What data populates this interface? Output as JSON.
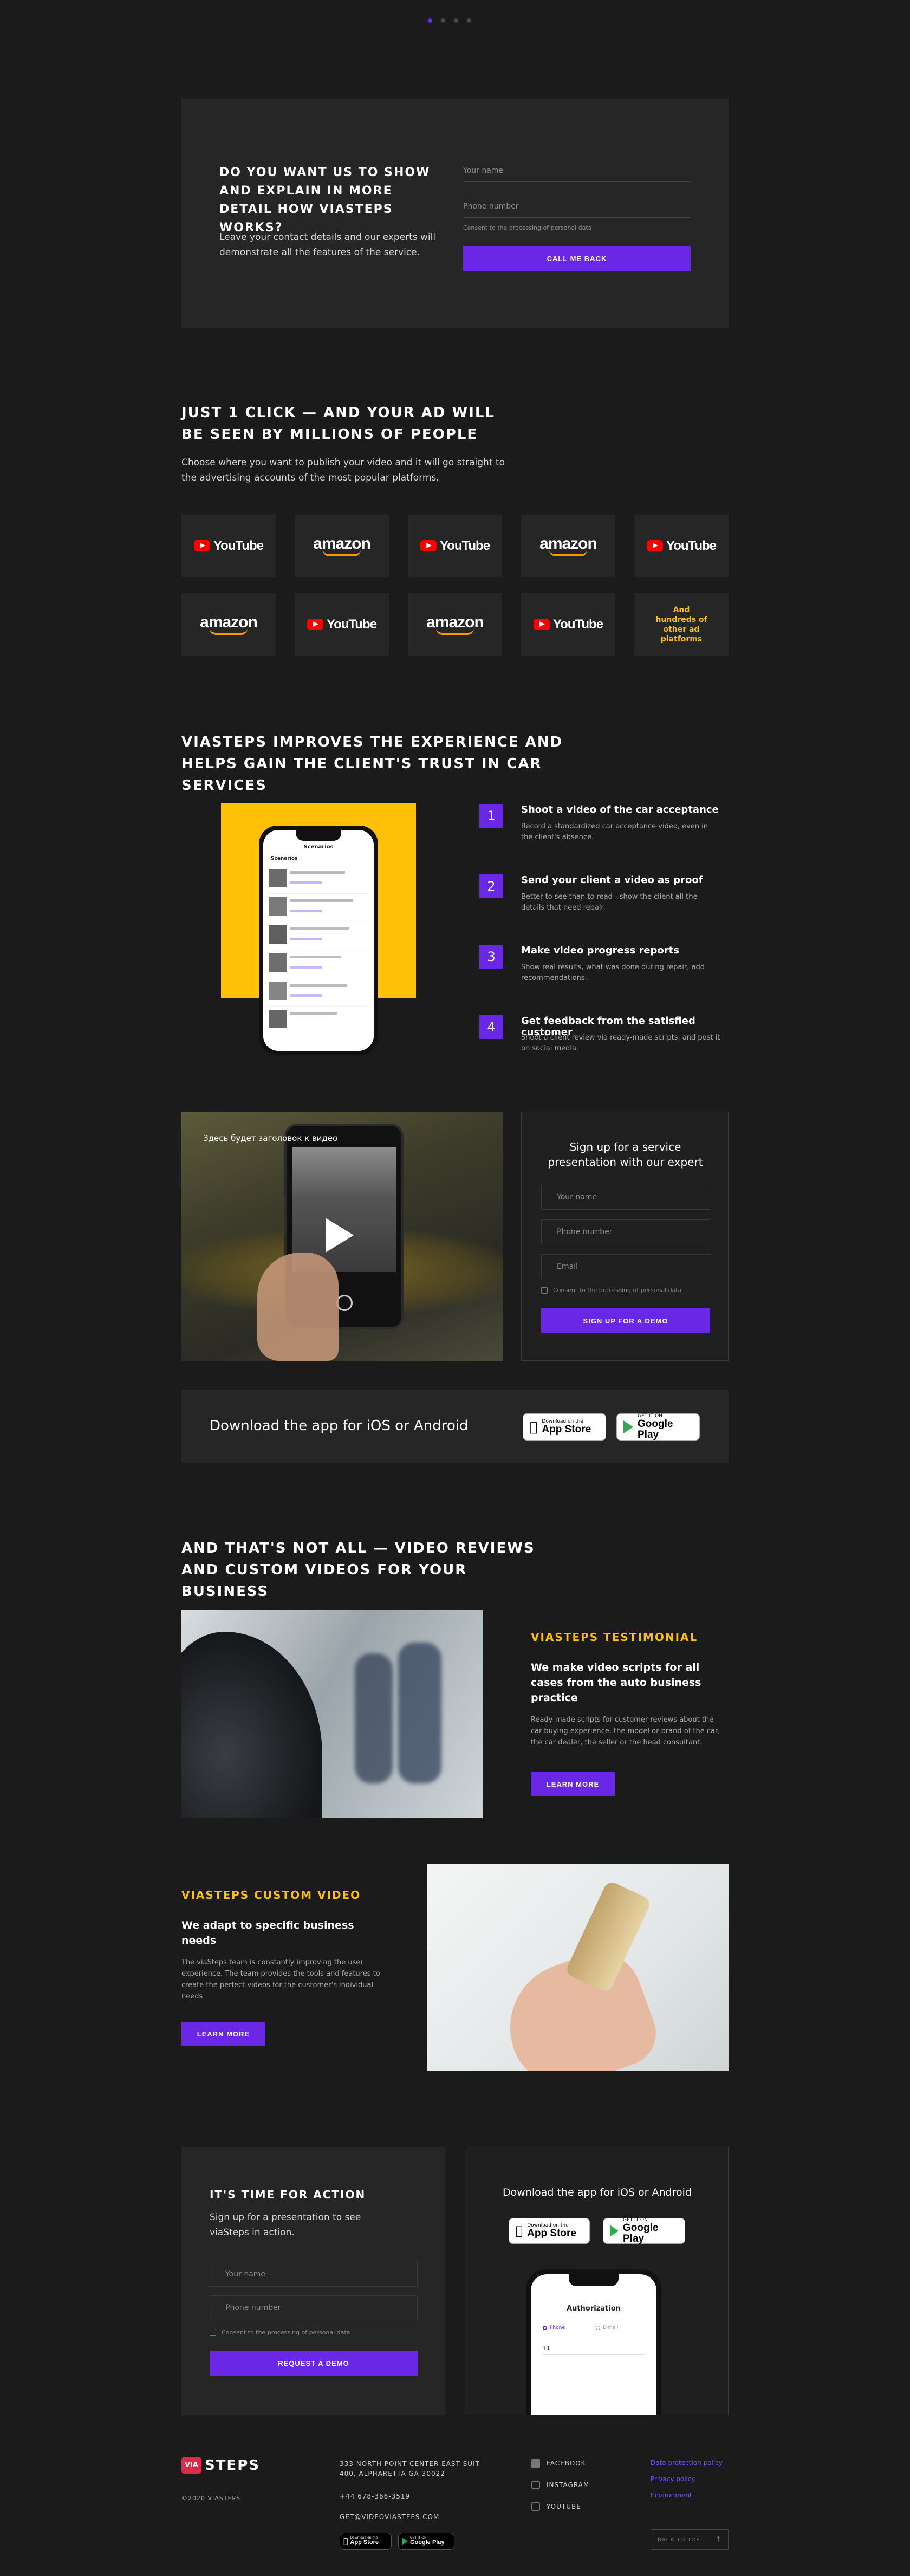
{
  "colors": {
    "accent": "#6a28e6",
    "yellow": "#ffc107",
    "bg": "#1b1b1b",
    "panel": "#232323"
  },
  "top_callback": {
    "heading": "DO YOU WANT US TO SHOW AND EXPLAIN IN MORE DETAIL HOW VIASTEPS WORKS?",
    "text": "Leave your contact details and our experts will demonstrate all the features of the service.",
    "name_placeholder": "Your name",
    "phone_placeholder": "Phone number",
    "consent": "Consent to the processing of personal data",
    "button": "CALL ME BACK"
  },
  "platforms": {
    "heading": "JUST 1 CLICK — AND YOUR AD WILL BE SEEN BY MILLIONS OF PEOPLE",
    "text": "Choose where you want to publish your video and it will go straight to the advertising accounts of the most popular platforms.",
    "youtube_label": "YouTube",
    "amazon_label": "amazon",
    "more_label": "And hundreds of other ad platforms"
  },
  "experience": {
    "heading": "VIASTEPS IMPROVES THE EXPERIENCE AND HELPS GAIN THE CLIENT'S TRUST IN CAR SERVICES",
    "phone_title": "Scenarios",
    "phone_subtitle": "Scenarios",
    "steps": [
      {
        "num": "1",
        "title": "Shoot a video of the car acceptance",
        "text": "Record a standardized car acceptance video, even in the client's absence."
      },
      {
        "num": "2",
        "title": "Send your client a video as proof",
        "text": "Better to see than to read - show the client all the details that need repair."
      },
      {
        "num": "3",
        "title": "Make video progress reports",
        "text": "Show real results, what was done during repair, add recommendations."
      },
      {
        "num": "4",
        "title": "Get feedback from the satisfied customer",
        "text": "Shoot a client review via ready-made scripts, and post it on social media."
      }
    ]
  },
  "demo": {
    "video_caption": "Здесь будет заголовок к видео",
    "heading": "Sign up for a service presentation with our expert",
    "name_placeholder": "Your name",
    "phone_placeholder": "Phone number",
    "email_placeholder": "Email",
    "consent": "Consent to the processing of personal data",
    "button": "SIGN UP FOR A DEMO"
  },
  "download_bar": {
    "text": "Download the app for iOS or Android",
    "appstore_small": "Download on the",
    "appstore_big": "App Store",
    "gplay_small": "GET IT ON",
    "gplay_big": "Google Play"
  },
  "reviews": {
    "heading": "AND THAT'S NOT ALL — VIDEO REVIEWS AND CUSTOM VIDEOS FOR YOUR BUSINESS",
    "testimonial": {
      "label": "VIASTEPS TESTIMONIAL",
      "title": "We make video scripts for all cases from the auto business practice",
      "text": "Ready-made scripts for customer reviews about the car-buying experience, the model or brand of the car, the car dealer, the seller or the head consultant.",
      "button": "LEARN MORE"
    },
    "custom": {
      "label": "VIASTEPS CUSTOM VIDEO",
      "title": "We adapt to specific business needs",
      "text": "The viaSteps team is constantly improving the user experience. The team provides the tools and features to create the perfect videos for the customer's individual needs",
      "button": "LEARN MORE"
    }
  },
  "action": {
    "heading": "IT'S TIME FOR ACTION",
    "text": "Sign up for a presentation to see viaSteps in action.",
    "name_placeholder": "Your name",
    "phone_placeholder": "Phone number",
    "consent": "Consent to the processing of personal data",
    "button": "REQUEST A DEMO",
    "download_heading": "Download the app for iOS or Android",
    "phone_title": "Authorization",
    "phone_option_a": "Phone",
    "phone_option_b": "E-mail",
    "phone_code": "+1"
  },
  "footer": {
    "logo_via": "VIA",
    "logo_steps": "STEPS",
    "copyright": "©2020 VIASTEPS",
    "address": "333 NORTH POINT CENTER EAST SUIT 400, ALPHARETTA GA 30022",
    "phone": "+44 678-366-3519",
    "email": "GET@VIDEOVIASTEPS.COM",
    "social": [
      "FACEBOOK",
      "INSTAGRAM",
      "YOUTUBE"
    ],
    "legal": [
      "Data protection policy",
      "Privacy policy",
      "Environment"
    ],
    "back_to_top": "BACK TO TOP",
    "appstore_small": "Download on the",
    "appstore_big": "App Store",
    "gplay_small": "GET IT ON",
    "gplay_big": "Google Play"
  }
}
